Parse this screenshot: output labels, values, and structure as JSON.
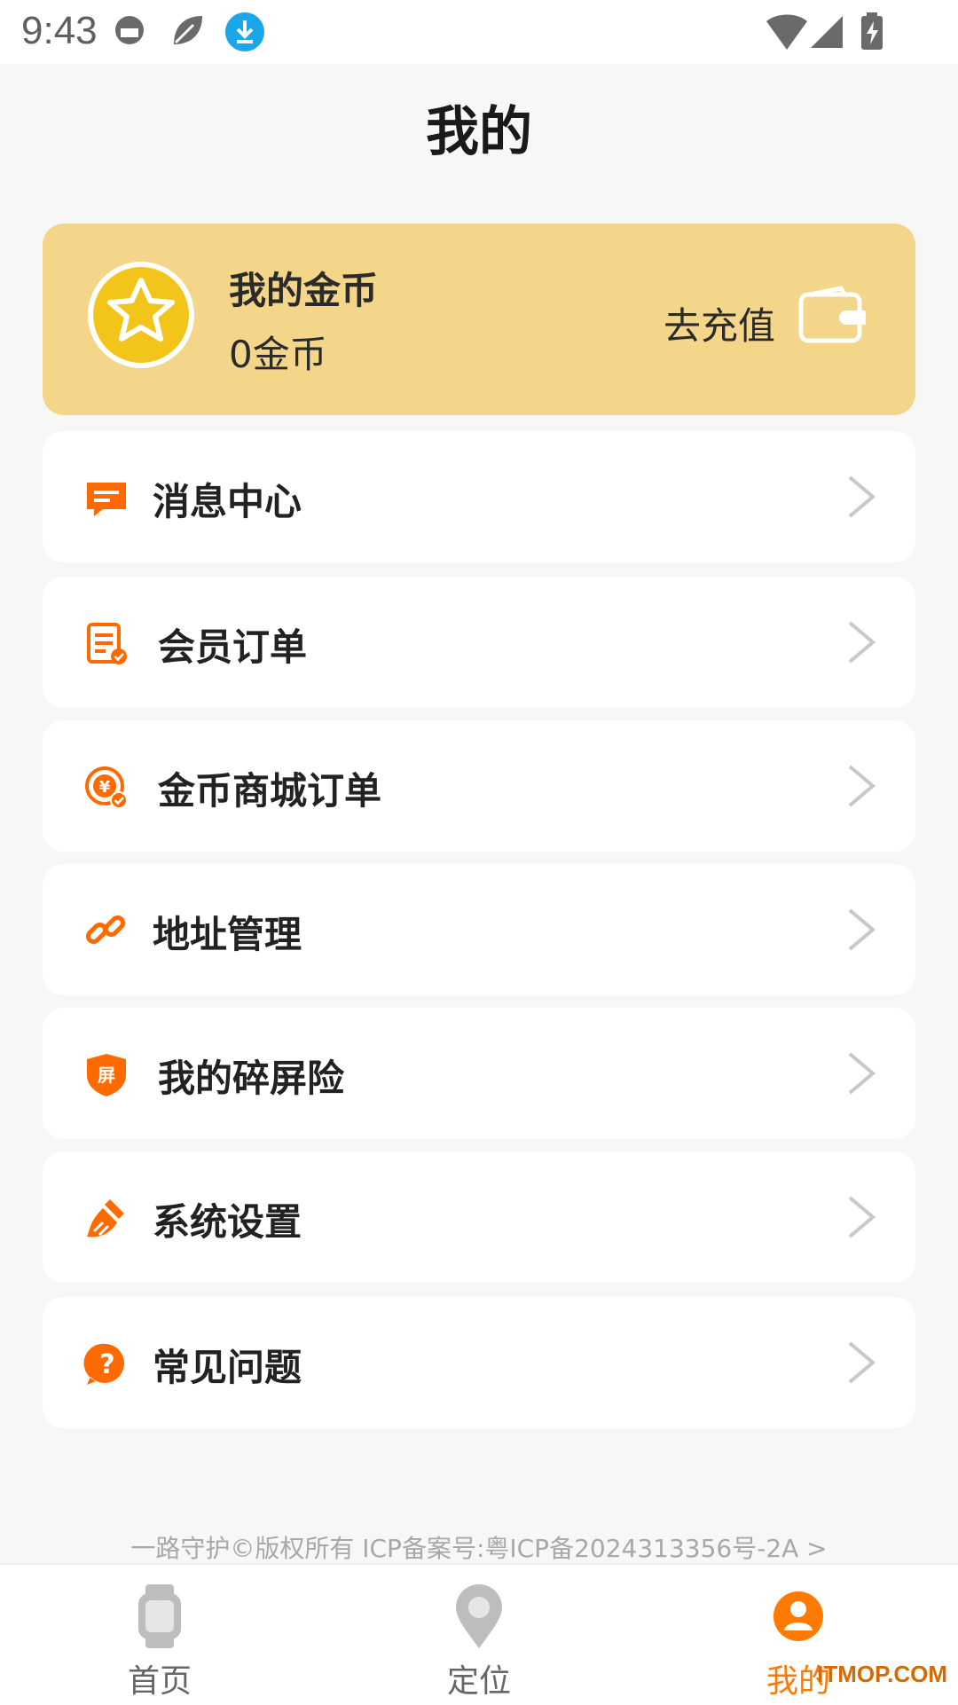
{
  "status_bar": {
    "time": "9:43"
  },
  "page_title": "我的",
  "coin_card": {
    "title": "我的金币",
    "amount": "0金币",
    "recharge_label": "去充值"
  },
  "menu": [
    {
      "label": "消息中心",
      "icon": "message-icon"
    },
    {
      "label": "会员订单",
      "icon": "order-icon"
    },
    {
      "label": "金币商城订单",
      "icon": "coin-mall-order-icon"
    },
    {
      "label": "地址管理",
      "icon": "link-icon"
    },
    {
      "label": "我的碎屏险",
      "icon": "screen-insurance-shield-icon"
    },
    {
      "label": "系统设置",
      "icon": "broom-icon"
    },
    {
      "label": "常见问题",
      "icon": "question-icon"
    }
  ],
  "footer_text": "一路守护©版权所有  ICP备案号:粤ICP备2024313356号-2A >",
  "tabs": [
    {
      "label": "首页",
      "icon": "watch-icon",
      "active": false
    },
    {
      "label": "定位",
      "icon": "location-pin-icon",
      "active": false
    },
    {
      "label": "我的",
      "icon": "user-profile-icon",
      "active": true
    }
  ],
  "watermark": "ITMOP.COM",
  "colors": {
    "accent": "#ff7a00",
    "card": "#f4d68a",
    "background": "#f7f7f7"
  }
}
